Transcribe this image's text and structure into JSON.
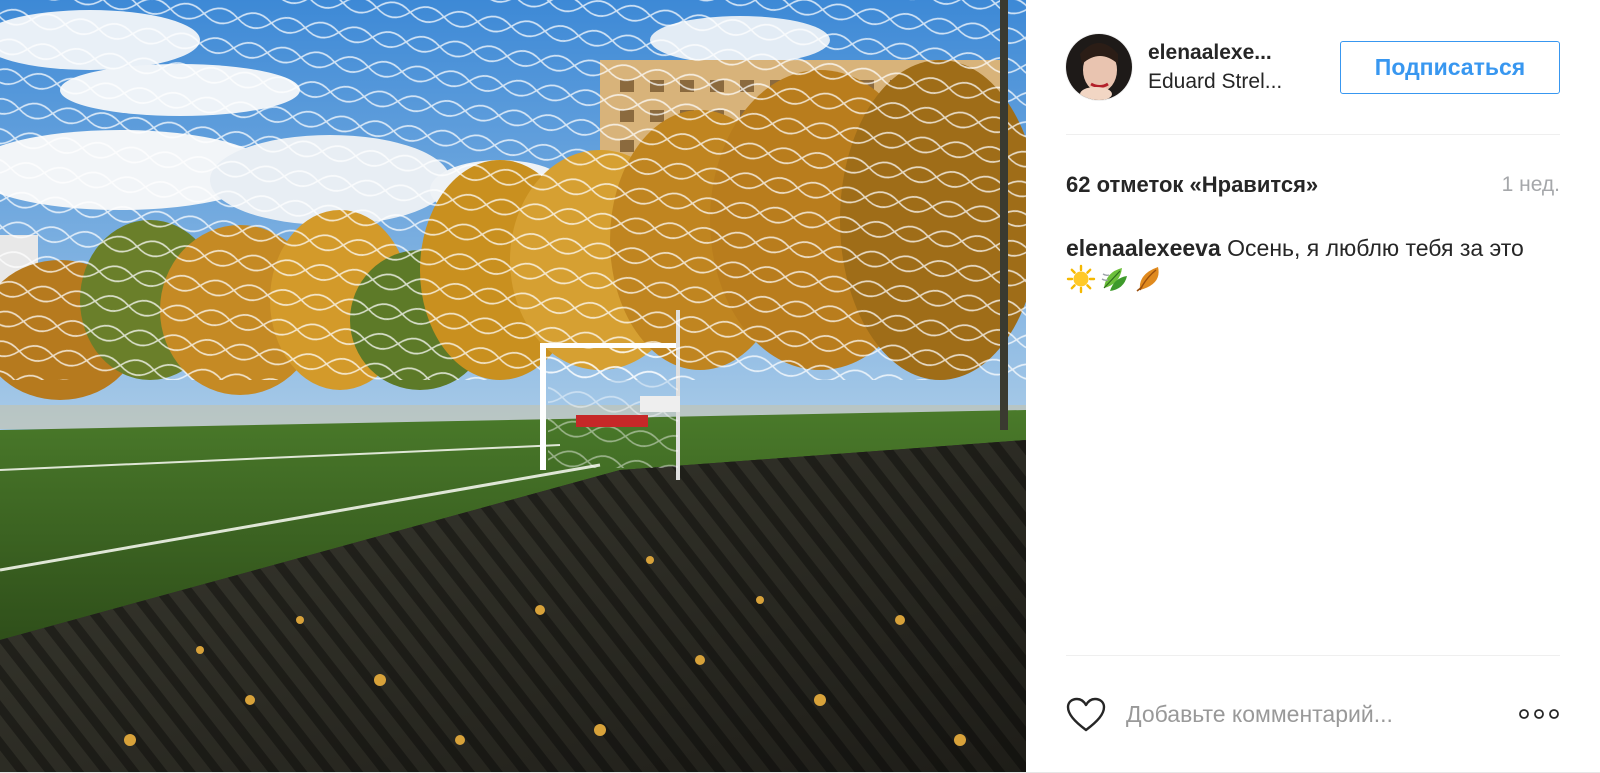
{
  "post": {
    "photo": {
      "description_icon": "football-net-photo"
    },
    "header": {
      "username": "elenaalexe...",
      "location": "Eduard Strel...",
      "follow_label": "Подписаться"
    },
    "meta": {
      "likes": "62 отметок «Нравится»",
      "time": "1 нед."
    },
    "caption": {
      "username": "elenaalexeeva",
      "text": " Осень, я люблю тебя за это ",
      "emojis": [
        "sun-emoji",
        "leaves-emoji",
        "fallen-leaf-emoji"
      ]
    },
    "footer": {
      "comment_placeholder": "Добавьте комментарий...",
      "like_icon": "heart-icon",
      "more_icon": "more-dots-icon"
    }
  },
  "colors": {
    "accent": "#3897f0",
    "text": "#262626",
    "muted": "#999999",
    "divider": "#efefef"
  }
}
